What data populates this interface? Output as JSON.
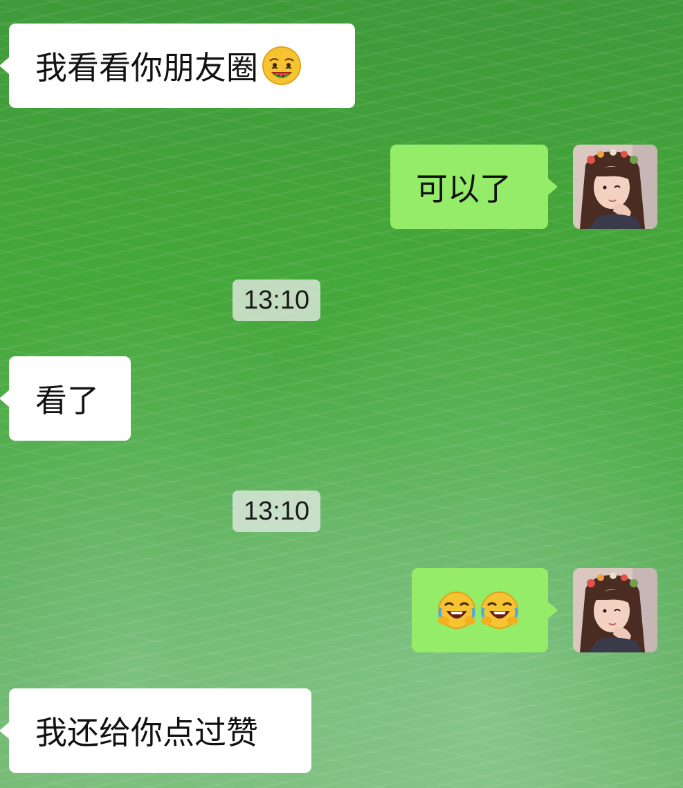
{
  "chat": {
    "messages": [
      {
        "id": "m1",
        "side": "incoming",
        "text": "我看看你朋友圈",
        "emoji": "drooling-face-icon"
      },
      {
        "id": "m2",
        "side": "outgoing",
        "text": "可以了"
      },
      {
        "id": "t1",
        "type": "timestamp",
        "text": "13:10"
      },
      {
        "id": "m3",
        "side": "incoming",
        "text": "看了"
      },
      {
        "id": "t2",
        "type": "timestamp",
        "text": "13:10"
      },
      {
        "id": "m4",
        "side": "outgoing",
        "emoji": [
          "rolling-on-floor-laughing-icon",
          "rolling-on-floor-laughing-icon"
        ]
      },
      {
        "id": "m5",
        "side": "incoming",
        "text": "我还给你点过赞"
      }
    ]
  },
  "theme": {
    "incoming_bubble": "#ffffff",
    "outgoing_bubble": "#95ec69",
    "background": "#45a83a"
  }
}
